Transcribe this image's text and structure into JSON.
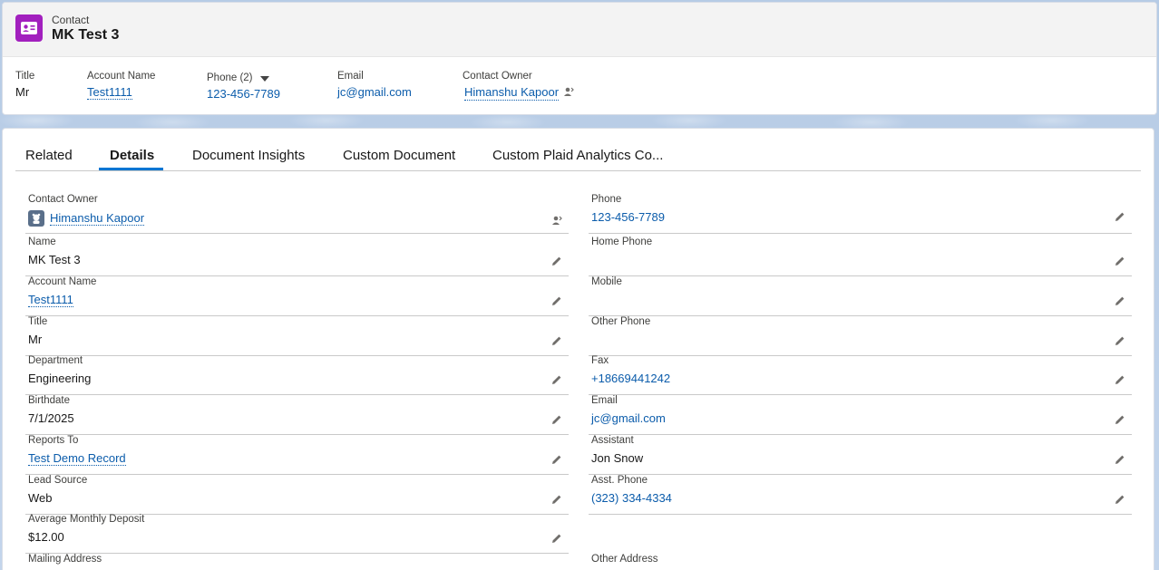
{
  "header": {
    "type_label": "Contact",
    "record_name": "MK Test 3",
    "icon": "contact-card-icon",
    "accent_color": "#a220be",
    "highlights": {
      "title_label": "Title",
      "title_value": "Mr",
      "account_label": "Account Name",
      "account_value": "Test1111",
      "phone_label": "Phone (2)",
      "phone_value": "123-456-7789",
      "email_label": "Email",
      "email_value": "jc@gmail.com",
      "owner_label": "Contact Owner",
      "owner_value": "Himanshu Kapoor"
    }
  },
  "tabs": [
    {
      "label": "Related"
    },
    {
      "label": "Details"
    },
    {
      "label": "Document Insights"
    },
    {
      "label": "Custom Document"
    },
    {
      "label": "Custom Plaid Analytics Co..."
    }
  ],
  "active_tab": "Details",
  "details": {
    "left": [
      {
        "label": "Contact Owner",
        "value": "Himanshu Kapoor"
      },
      {
        "label": "Name",
        "value": "MK Test 3"
      },
      {
        "label": "Account Name",
        "value": "Test1111"
      },
      {
        "label": "Title",
        "value": "Mr"
      },
      {
        "label": "Department",
        "value": "Engineering"
      },
      {
        "label": "Birthdate",
        "value": "7/1/2025"
      },
      {
        "label": "Reports To",
        "value": "Test Demo Record"
      },
      {
        "label": "Lead Source",
        "value": "Web"
      },
      {
        "label": "Average Monthly Deposit",
        "value": "$12.00"
      },
      {
        "label": "Mailing Address",
        "value": ""
      }
    ],
    "right": [
      {
        "label": "Phone",
        "value": "123-456-7789"
      },
      {
        "label": "Home Phone",
        "value": ""
      },
      {
        "label": "Mobile",
        "value": ""
      },
      {
        "label": "Other Phone",
        "value": ""
      },
      {
        "label": "Fax",
        "value": "+18669441242"
      },
      {
        "label": "Email",
        "value": "jc@gmail.com"
      },
      {
        "label": "Assistant",
        "value": "Jon Snow"
      },
      {
        "label": "Asst. Phone",
        "value": "(323) 334-4334"
      },
      {
        "label": "Other Address",
        "value": ""
      }
    ]
  }
}
